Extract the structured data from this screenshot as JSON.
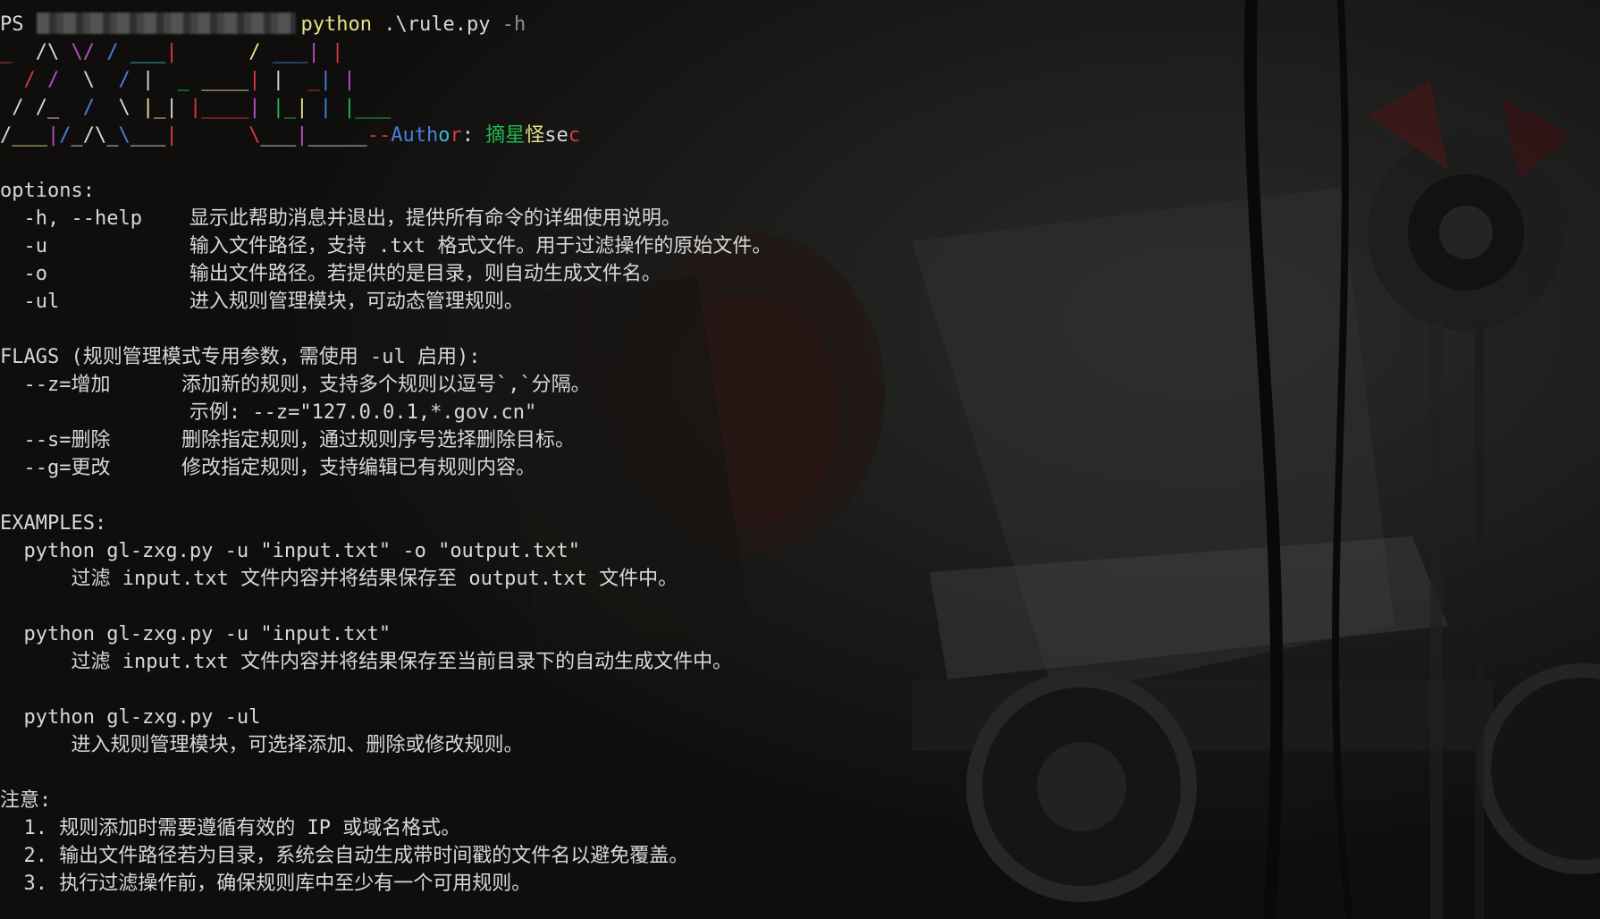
{
  "prompt": {
    "ps": "PS",
    "cmd": "python",
    "arg": ".\\rule.py",
    "flag": "-h"
  },
  "banner": {
    "line1": [
      {
        "t": "_ ",
        "c": "c-red"
      },
      {
        "t": " /\\ ",
        "c": "c-white"
      },
      {
        "t": "\\/ ",
        "c": "c-magenta"
      },
      {
        "t": "/ ",
        "c": "c-blue"
      },
      {
        "t": "___",
        "c": "c-cyan"
      },
      {
        "t": "|      ",
        "c": "c-red"
      },
      {
        "t": "/ ",
        "c": "c-yellow"
      },
      {
        "t": "___",
        "c": "c-blue"
      },
      {
        "t": "|",
        "c": "c-magenta"
      },
      {
        "t": " |",
        "c": "c-red"
      }
    ],
    "line2": [
      {
        "t": "  / ",
        "c": "c-red"
      },
      {
        "t": "/ ",
        "c": "c-magenta"
      },
      {
        "t": " \\ ",
        "c": "c-white"
      },
      {
        "t": " / ",
        "c": "c-blue"
      },
      {
        "t": "| ",
        "c": "c-white"
      },
      {
        "t": " _ ",
        "c": "c-green"
      },
      {
        "t": "____",
        "c": "c-yellow"
      },
      {
        "t": "| ",
        "c": "c-red"
      },
      {
        "t": "|",
        "c": "c-white"
      },
      {
        "t": "  _",
        "c": "c-red"
      },
      {
        "t": "| ",
        "c": "c-blue"
      },
      {
        "t": "|",
        "c": "c-magenta"
      }
    ],
    "line3": [
      {
        "t": " / ",
        "c": "c-white"
      },
      {
        "t": "/_ ",
        "c": "c-white"
      },
      {
        "t": " / ",
        "c": "c-blue"
      },
      {
        "t": " \\ ",
        "c": "c-white"
      },
      {
        "t": "|_",
        "c": "c-yellow"
      },
      {
        "t": "| ",
        "c": "c-white"
      },
      {
        "t": "|____",
        "c": "c-red"
      },
      {
        "t": "| ",
        "c": "c-magenta"
      },
      {
        "t": "|_",
        "c": "c-green"
      },
      {
        "t": "| ",
        "c": "c-yellow"
      },
      {
        "t": "| ",
        "c": "c-blue"
      },
      {
        "t": "|___",
        "c": "c-green"
      }
    ],
    "line4": [
      {
        "t": "/",
        "c": "c-white"
      },
      {
        "t": "___",
        "c": "c-yellow"
      },
      {
        "t": "|",
        "c": "c-magenta"
      },
      {
        "t": "/",
        "c": "c-blue"
      },
      {
        "t": "_",
        "c": "c-white"
      },
      {
        "t": "/\\",
        "c": "c-white"
      },
      {
        "t": "_",
        "c": "c-white"
      },
      {
        "t": "\\",
        "c": "c-blue"
      },
      {
        "t": "___",
        "c": "c-white"
      },
      {
        "t": "|      ",
        "c": "c-red"
      },
      {
        "t": "\\",
        "c": "c-red"
      },
      {
        "t": "___",
        "c": "c-white"
      },
      {
        "t": "|",
        "c": "c-magenta"
      },
      {
        "t": "_____",
        "c": "c-white"
      },
      {
        "t": "--",
        "c": "c-red"
      },
      {
        "t": "Auth",
        "c": "c-blue"
      },
      {
        "t": "o",
        "c": "c-cyan"
      },
      {
        "t": "r",
        "c": "c-red"
      },
      {
        "t": ": ",
        "c": "c-white"
      },
      {
        "t": "摘星",
        "c": "c-green"
      },
      {
        "t": "怪",
        "c": "c-yellow"
      },
      {
        "t": "se",
        "c": "c-white"
      },
      {
        "t": "c",
        "c": "c-red"
      }
    ]
  },
  "lines": [
    "",
    "options:",
    "  -h, --help    显示此帮助消息并退出，提供所有命令的详细使用说明。",
    "  -u            输入文件路径，支持 .txt 格式文件。用于过滤操作的原始文件。",
    "  -o            输出文件路径。若提供的是目录，则自动生成文件名。",
    "  -ul           进入规则管理模块，可动态管理规则。",
    "",
    "FLAGS (规则管理模式专用参数，需使用 -ul 启用):",
    "  --z=增加      添加新的规则，支持多个规则以逗号`,`分隔。",
    "                示例: --z=\"127.0.0.1,*.gov.cn\"",
    "  --s=删除      删除指定规则，通过规则序号选择删除目标。",
    "  --g=更改      修改指定规则，支持编辑已有规则内容。",
    "",
    "EXAMPLES:",
    "  python gl-zxg.py -u \"input.txt\" -o \"output.txt\"",
    "      过滤 input.txt 文件内容并将结果保存至 output.txt 文件中。",
    "",
    "  python gl-zxg.py -u \"input.txt\"",
    "      过滤 input.txt 文件内容并将结果保存至当前目录下的自动生成文件中。",
    "",
    "  python gl-zxg.py -ul",
    "      进入规则管理模块，可选择添加、删除或修改规则。",
    "",
    "注意:",
    "  1. 规则添加时需要遵循有效的 IP 或域名格式。",
    "  2. 输出文件路径若为目录，系统会自动生成带时间戳的文件名以避免覆盖。",
    "  3. 执行过滤操作前，确保规则库中至少有一个可用规则。"
  ]
}
